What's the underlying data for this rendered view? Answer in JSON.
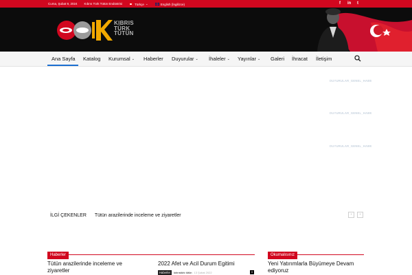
{
  "topbar": {
    "date": "Cuma, Şubat 9, 2024",
    "company": "Kıbrıs Türk Tütün Endüstrisi",
    "lang_tr": "Türkçe",
    "lang_en": "English (İngilizce)",
    "social": [
      "f",
      "in",
      "t"
    ]
  },
  "logo": {
    "line1": "KIBRIS",
    "line2": "TÜRK",
    "line3": "TÜTÜN"
  },
  "nav": {
    "items": [
      {
        "label": "Ana Sayfa",
        "dropdown": false,
        "active": true
      },
      {
        "label": "Katalog",
        "dropdown": false
      },
      {
        "label": "Kurumsal",
        "dropdown": true
      },
      {
        "label": "Haberler",
        "dropdown": false
      },
      {
        "label": "Duyurular",
        "dropdown": true
      },
      {
        "label": "İhaleler",
        "dropdown": true
      },
      {
        "label": "Yayınlar",
        "dropdown": true
      },
      {
        "label": "Galeri",
        "dropdown": false
      },
      {
        "label": "İhracat",
        "dropdown": false
      },
      {
        "label": "İletişim",
        "dropdown": false
      }
    ],
    "chevron": "⌄"
  },
  "sidebar_labels": [
    "DUYURULAR_GENEL_HABE",
    "DUYURULAR_GENEL_HABE",
    "DUYURULAR_GENEL_HABE"
  ],
  "ilgi": {
    "label": "İLGİ ÇEKENLER",
    "link": "Tütün arazilerinde inceleme ve ziyaretler",
    "prev": "‹",
    "next": "›"
  },
  "sections": {
    "haberler": "Haberler",
    "okumalisiniz": "Okumalısınız"
  },
  "posts": {
    "p1_title": "Tütün arazilerinde inceleme ve ziyaretler",
    "p2_title": "2022 Afet ve Acil Durum Egitimi",
    "p2_category": "Haberler",
    "p2_author": "kıbrıstürk tütün",
    "p2_date": "13 Şubat 2022",
    "p2_comments": "0",
    "p3_title": "Yeni Yatırımlarla Büyümeye Devam ediyoruz"
  },
  "colors": {
    "brand_red": "#d1071f",
    "nav_active": "#1b6fd1",
    "header_bg": "#0c0c0c"
  }
}
